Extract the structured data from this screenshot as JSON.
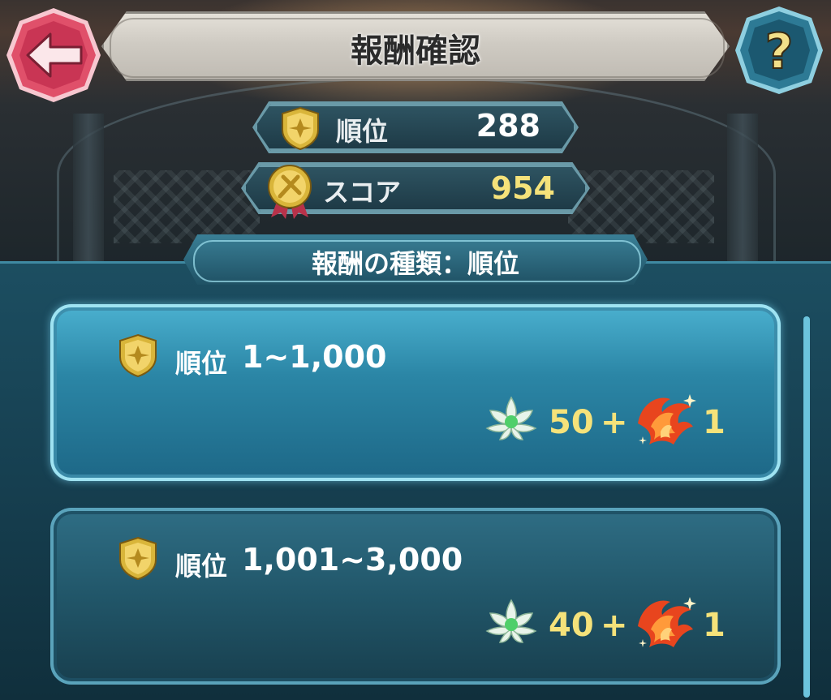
{
  "header": {
    "title": "報酬確認",
    "back_icon": "back-arrow-icon",
    "help_icon": "help-question-icon",
    "help_glyph": "?"
  },
  "stats": {
    "rank_label": "順位",
    "rank_value": "288",
    "score_label": "スコア",
    "score_value": "954"
  },
  "reward_type": {
    "label": "報酬の種類：順位"
  },
  "rewards": [
    {
      "rank_label": "順位",
      "rank_range": "1~1,000",
      "item1_icon": "lotus-icon",
      "item1_amount": "50",
      "plus": "+",
      "item2_icon": "phoenix-icon",
      "item2_amount": "1"
    },
    {
      "rank_label": "順位",
      "rank_range": "1,001~3,000",
      "item1_icon": "lotus-icon",
      "item1_amount": "40",
      "plus": "+",
      "item2_icon": "phoenix-icon",
      "item2_amount": "1"
    }
  ],
  "colors": {
    "gold_text": "#f5e27a",
    "panel": "#1c4e61",
    "active_card": "#2b86a6",
    "back_button": "#e0506a"
  }
}
